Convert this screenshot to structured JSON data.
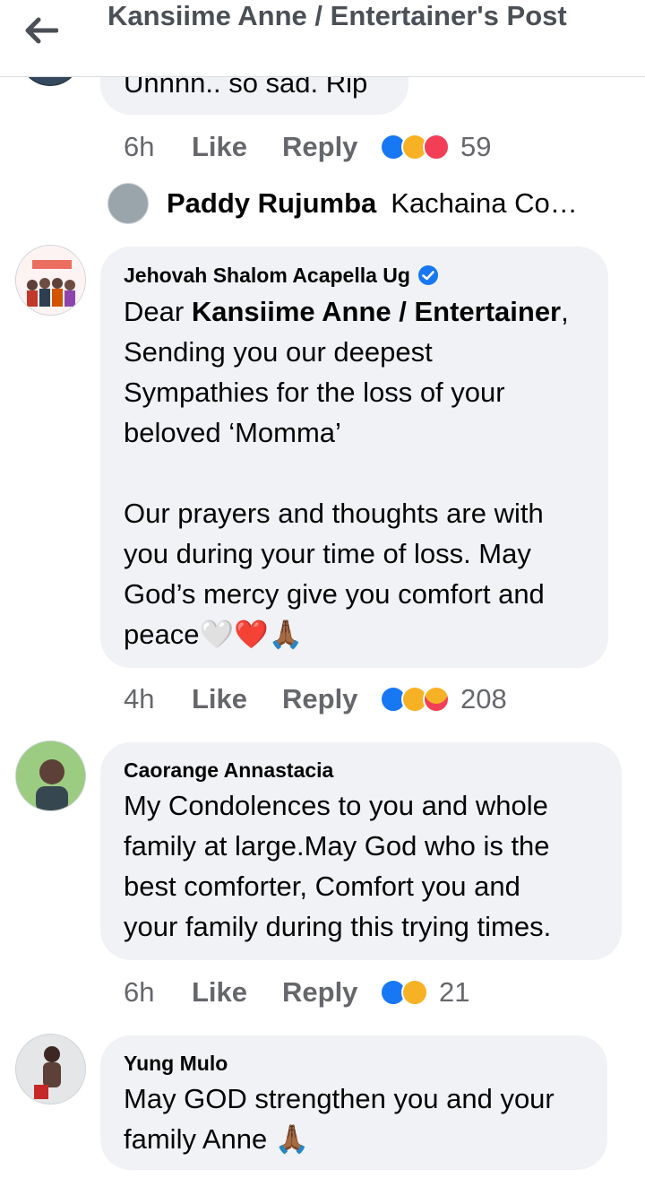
{
  "header": {
    "title": "Kansiime Anne / Entertainer's Post"
  },
  "colors": {
    "accent": "#1877f2",
    "sad": "#f7b125",
    "love": "#f33e58",
    "muted": "#65676b",
    "bubble": "#f0f2f5"
  },
  "comment0": {
    "text": "Unnnn.. so sad. Rip",
    "time": "6h",
    "like": "Like",
    "reply": "Reply",
    "count": "59",
    "reactions": [
      "like-icon",
      "sad-icon",
      "love-icon"
    ]
  },
  "reply_preview": {
    "name": "Paddy Rujumba",
    "text": "Kachaina Co…"
  },
  "comments": [
    {
      "author": "Jehovah Shalom Acapella Ug",
      "verified": true,
      "greeting": "Dear",
      "mention": "Kansiime Anne / Entertainer",
      "line2": "Sending you our deepest",
      "line3": "Sympathies for the loss of your",
      "line4": "beloved ‘Momma’",
      "line5": "Our prayers and thoughts are with",
      "line6": "you during your time of loss. May",
      "line7": "God’s mercy give you comfort and",
      "line8": "peace",
      "emojis": "🤍❤️🙏🏾",
      "time": "4h",
      "like": "Like",
      "reply": "Reply",
      "count": "208",
      "reactions": [
        "like-icon",
        "sad-icon",
        "care-icon"
      ]
    },
    {
      "author": "Caorange Annastacia",
      "line1": "My Condolences to you and whole",
      "line2": "family at large.May God who is the",
      "line3": "best comforter, Comfort you and",
      "line4": "your family during this trying times.",
      "time": "6h",
      "like": "Like",
      "reply": "Reply",
      "count": "21",
      "reactions": [
        "like-icon",
        "sad-icon"
      ]
    },
    {
      "author": "Yung Mulo",
      "line1": "May GOD strengthen you and your",
      "line2": "family Anne",
      "emoji": "🙏🏾"
    }
  ]
}
